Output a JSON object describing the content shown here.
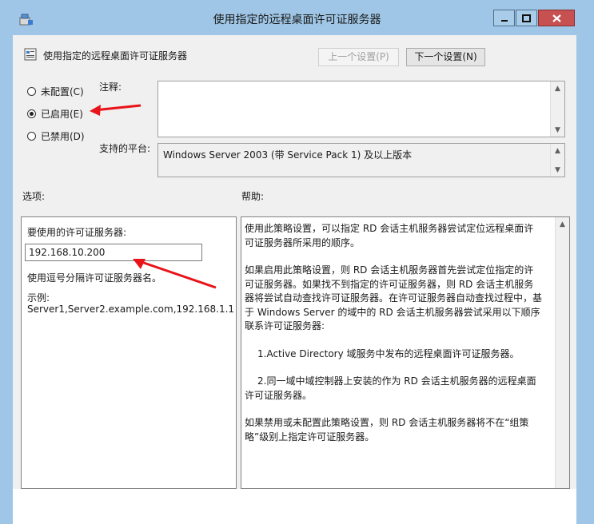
{
  "window": {
    "title": "使用指定的远程桌面许可证服务器"
  },
  "header": {
    "policy_name": "使用指定的远程桌面许可证服务器",
    "prev_button": "上一个设置(P)",
    "next_button": "下一个设置(N)"
  },
  "state": {
    "options": [
      {
        "label": "未配置(C)",
        "checked": false
      },
      {
        "label": "已启用(E)",
        "checked": true
      },
      {
        "label": "已禁用(D)",
        "checked": false
      }
    ]
  },
  "comment": {
    "label": "注释:",
    "value": ""
  },
  "platform": {
    "label": "支持的平台:",
    "value": "Windows Server 2003 (带 Service Pack 1) 及以上版本"
  },
  "options_section": {
    "label": "选项:",
    "field_label": "要使用的许可证服务器:",
    "field_value": "192.168.10.200",
    "hint": "使用逗号分隔许可证服务器名。",
    "example_label": "示例:",
    "example_value": "Server1,Server2.example.com,192.168.1.1"
  },
  "help_section": {
    "label": "帮助:",
    "paragraphs": [
      "使用此策略设置，可以指定 RD 会话主机服务器尝试定位远程桌面许可证服务器所采用的顺序。",
      "如果启用此策略设置，则 RD 会话主机服务器首先尝试定位指定的许可证服务器。如果找不到指定的许可证服务器，则 RD 会话主机服务器将尝试自动查找许可证服务器。在许可证服务器自动查找过程中，基于 Windows Server 的域中的 RD 会话主机服务器尝试采用以下顺序联系许可证服务器:",
      "1.Active Directory 域服务中发布的远程桌面许可证服务器。",
      "2.同一域中域控制器上安装的作为 RD 会话主机服务器的远程桌面许可证服务器。",
      "如果禁用或未配置此策略设置，则 RD 会话主机服务器将不在“组策略”级别上指定许可证服务器。"
    ]
  },
  "colors": {
    "frame": "#9fc6e6",
    "annotation_arrow": "#e8141a"
  }
}
